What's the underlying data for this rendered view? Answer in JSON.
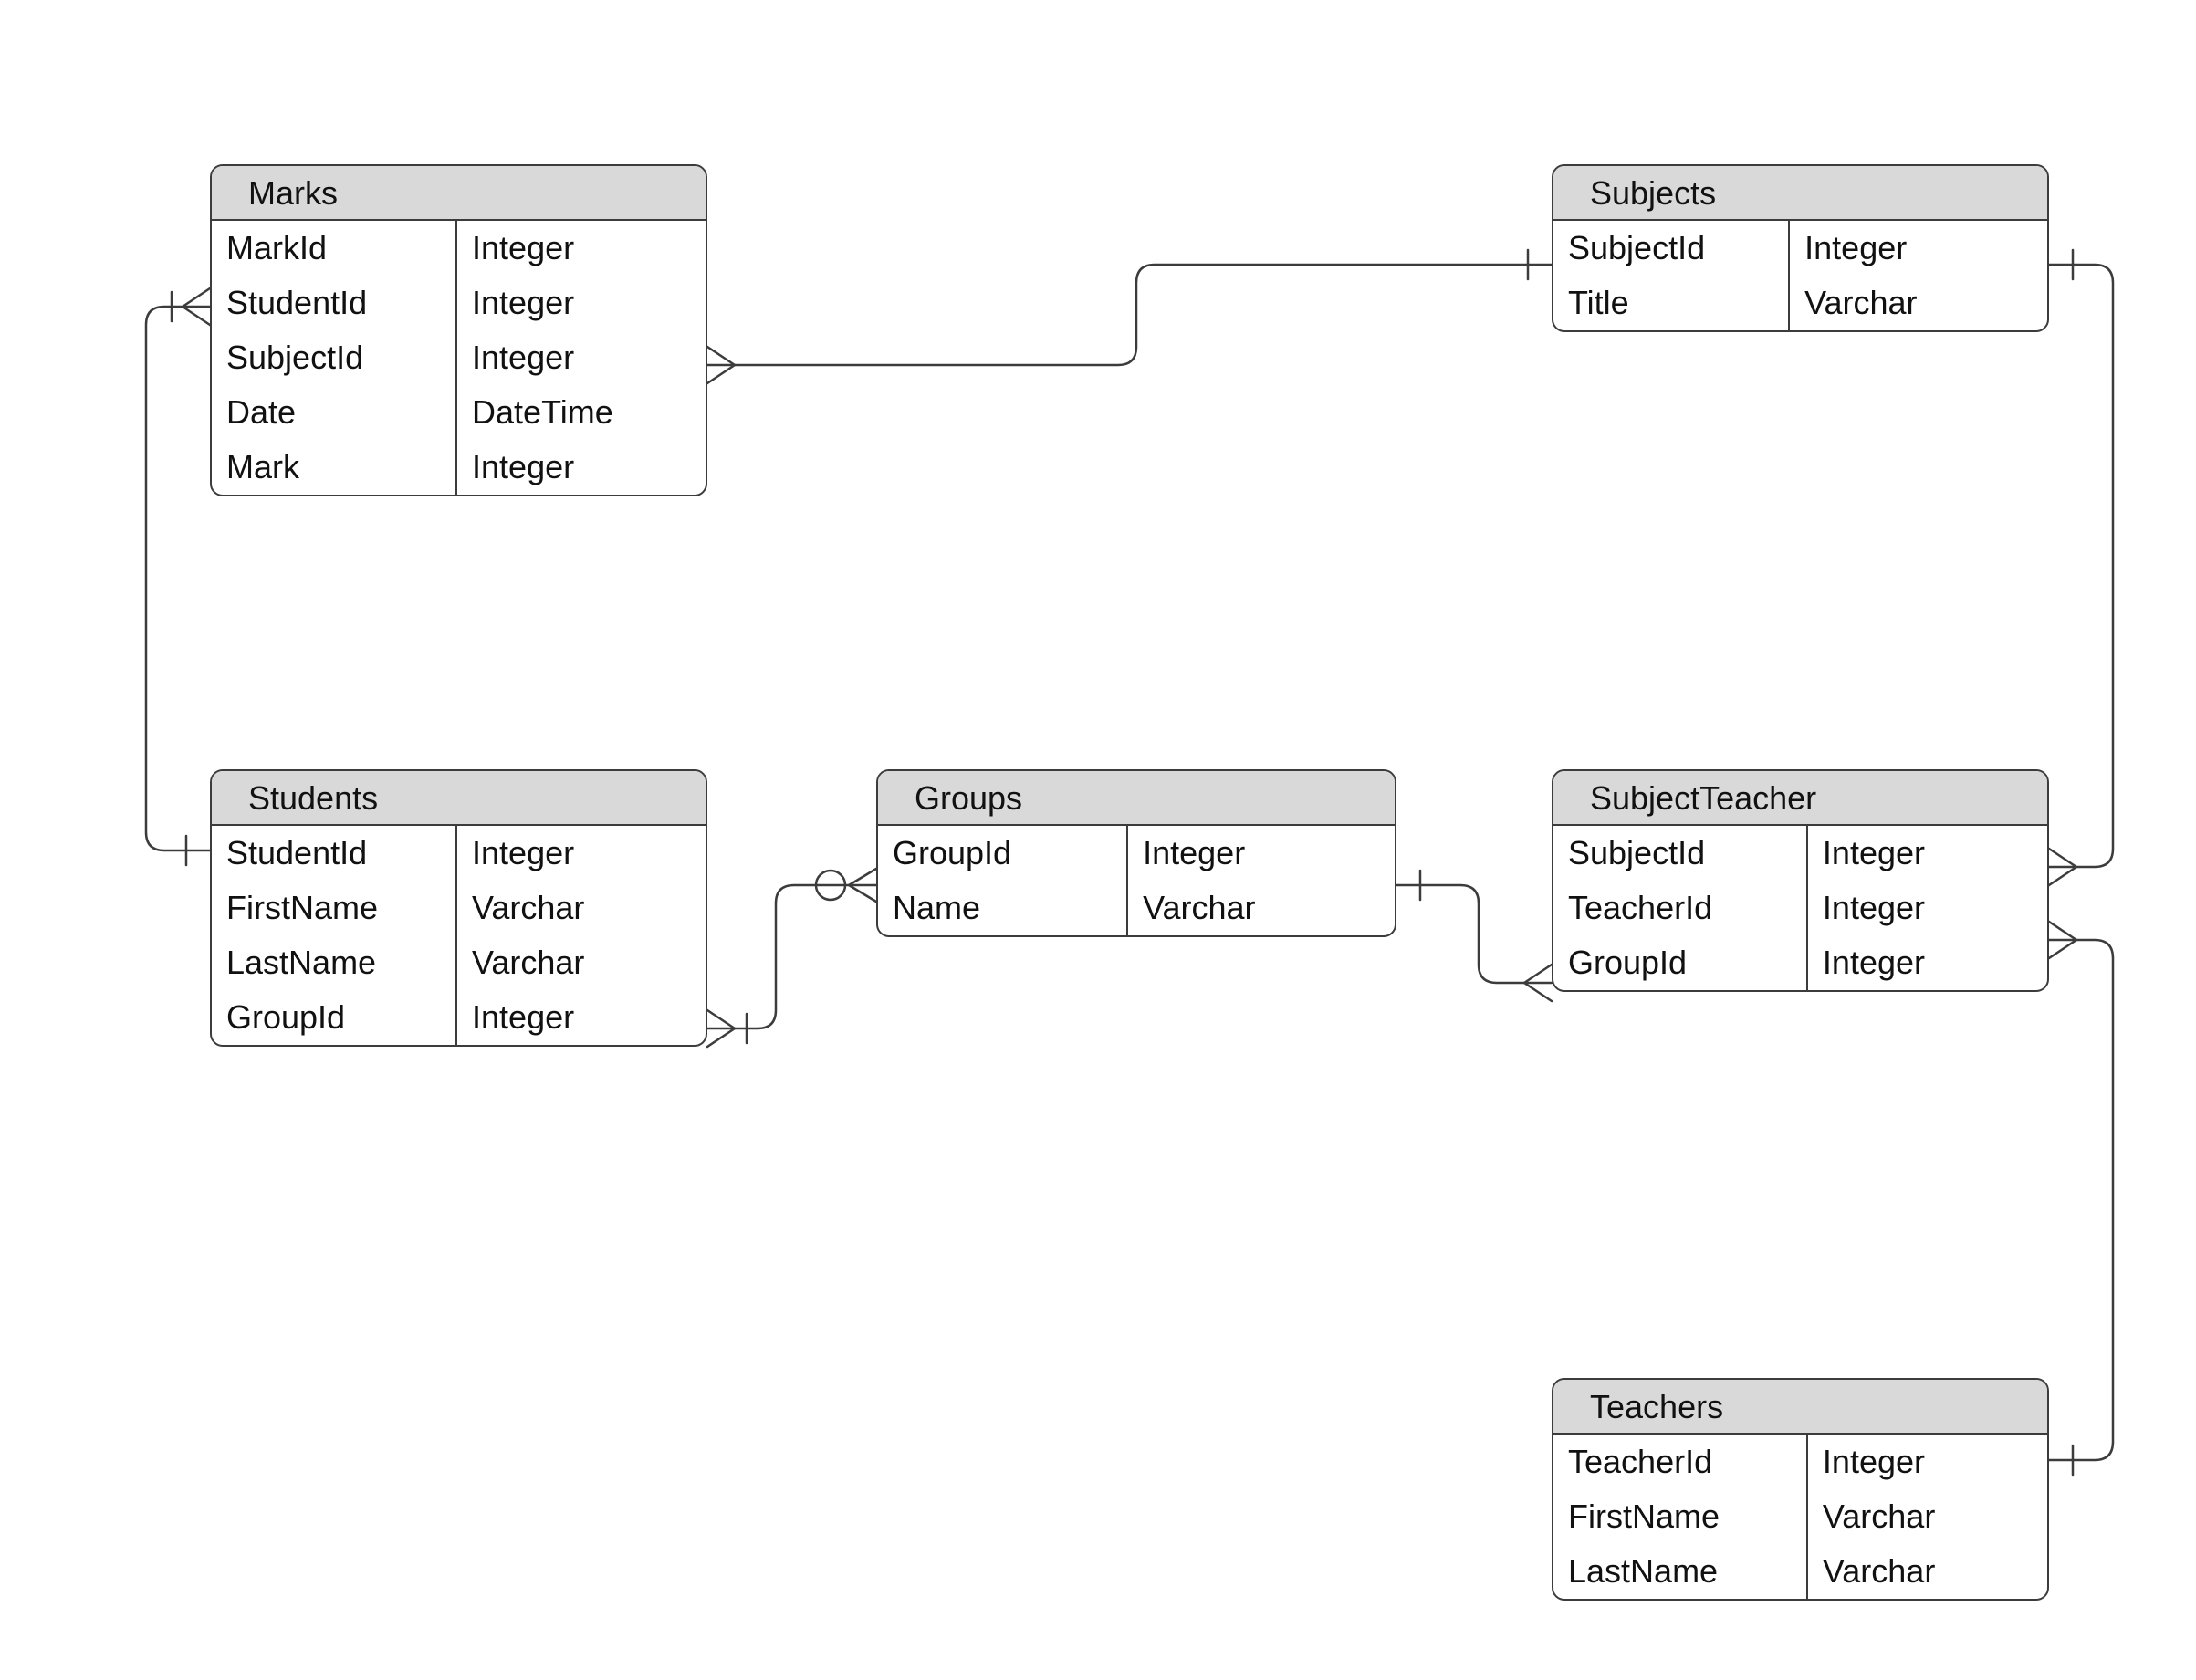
{
  "diagram_type": "entity-relationship",
  "entities": [
    {
      "name": "Marks",
      "fields": [
        {
          "name": "MarkId",
          "type": "Integer"
        },
        {
          "name": "StudentId",
          "type": "Integer"
        },
        {
          "name": "SubjectId",
          "type": "Integer"
        },
        {
          "name": "Date",
          "type": "DateTime"
        },
        {
          "name": "Mark",
          "type": "Integer"
        }
      ]
    },
    {
      "name": "Subjects",
      "fields": [
        {
          "name": "SubjectId",
          "type": "Integer"
        },
        {
          "name": "Title",
          "type": "Varchar"
        }
      ]
    },
    {
      "name": "Students",
      "fields": [
        {
          "name": "StudentId",
          "type": "Integer"
        },
        {
          "name": "FirstName",
          "type": "Varchar"
        },
        {
          "name": "LastName",
          "type": "Varchar"
        },
        {
          "name": "GroupId",
          "type": "Integer"
        }
      ]
    },
    {
      "name": "Groups",
      "fields": [
        {
          "name": "GroupId",
          "type": "Integer"
        },
        {
          "name": "Name",
          "type": "Varchar"
        }
      ]
    },
    {
      "name": "SubjectTeacher",
      "fields": [
        {
          "name": "SubjectId",
          "type": "Integer"
        },
        {
          "name": "TeacherId",
          "type": "Integer"
        },
        {
          "name": "GroupId",
          "type": "Integer"
        }
      ]
    },
    {
      "name": "Teachers",
      "fields": [
        {
          "name": "TeacherId",
          "type": "Integer"
        },
        {
          "name": "FirstName",
          "type": "Varchar"
        },
        {
          "name": "LastName",
          "type": "Varchar"
        }
      ]
    }
  ],
  "relationships": [
    {
      "from": "Students",
      "from_card": "one",
      "to": "Marks",
      "to_card": "many"
    },
    {
      "from": "Subjects",
      "from_card": "one",
      "to": "Marks",
      "to_card": "many"
    },
    {
      "from": "Groups",
      "from_card": "zero-or-one",
      "to": "Students",
      "to_card": "many"
    },
    {
      "from": "Groups",
      "from_card": "one",
      "to": "SubjectTeacher",
      "to_card": "many"
    },
    {
      "from": "Subjects",
      "from_card": "one",
      "to": "SubjectTeacher",
      "to_card": "many"
    },
    {
      "from": "Teachers",
      "from_card": "one",
      "to": "SubjectTeacher",
      "to_card": "many"
    }
  ],
  "colors": {
    "stroke": "#3c3c3c",
    "header_fill": "#d9d9d9",
    "body_fill": "#ffffff"
  }
}
